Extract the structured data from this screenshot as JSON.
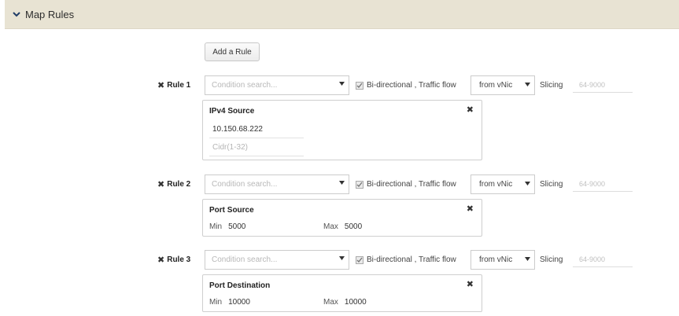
{
  "section": {
    "title": "Map Rules"
  },
  "add_rule_label": "Add a Rule",
  "rules": [
    {
      "label": "Rule 1",
      "condition_placeholder": "Condition search...",
      "bidirectional_label": "Bi-directional , Traffic flow",
      "traffic_flow": "from vNic",
      "slicing_label": "Slicing",
      "slicing_placeholder": "64-9000",
      "card": {
        "title": "IPv4 Source",
        "address": "10.150.68.222",
        "cidr_placeholder": "Cidr(1-32)"
      }
    },
    {
      "label": "Rule 2",
      "condition_placeholder": "Condition search...",
      "bidirectional_label": "Bi-directional , Traffic flow",
      "traffic_flow": "from vNic",
      "slicing_label": "Slicing",
      "slicing_placeholder": "64-9000",
      "card": {
        "title": "Port Source",
        "min_label": "Min",
        "min_value": "5000",
        "max_label": "Max",
        "max_value": "5000"
      }
    },
    {
      "label": "Rule 3",
      "condition_placeholder": "Condition search...",
      "bidirectional_label": "Bi-directional , Traffic flow",
      "traffic_flow": "from vNic",
      "slicing_label": "Slicing",
      "slicing_placeholder": "64-9000",
      "card": {
        "title": "Port Destination",
        "min_label": "Min",
        "min_value": "10000",
        "max_label": "Max",
        "max_value": "10000"
      }
    }
  ],
  "icons": {
    "section_toggle": "chevron-down-icon",
    "remove_rule": "close-icon",
    "dropdown": "caret-down-icon",
    "checkbox": "check-icon"
  },
  "colors": {
    "header_bg": "#e8e3d3",
    "border": "#cccccc"
  }
}
